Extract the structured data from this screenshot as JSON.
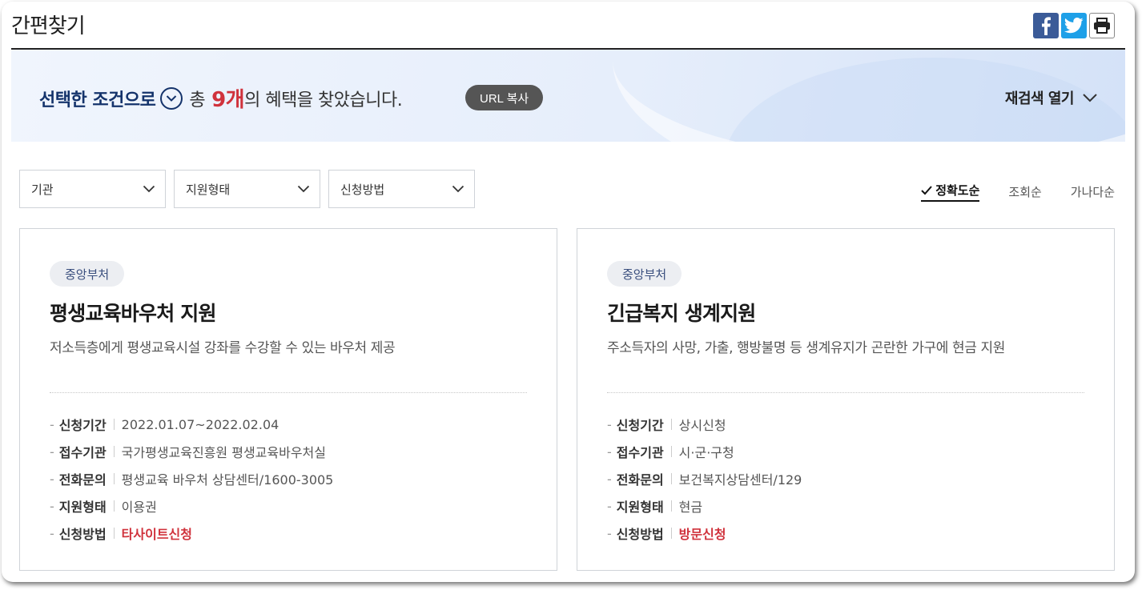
{
  "page": {
    "title": "간편찾기"
  },
  "share": {
    "icons": [
      "facebook-icon",
      "twitter-icon",
      "print-icon"
    ]
  },
  "banner": {
    "prefix": "선택한 조건으로",
    "total_label": "총",
    "count": "9개",
    "suffix": "의 혜택을 찾았습니다.",
    "url_copy": "URL 복사",
    "reopen": "재검색 열기"
  },
  "filters": [
    {
      "label": "기관"
    },
    {
      "label": "지원형태"
    },
    {
      "label": "신청방법"
    }
  ],
  "sort": [
    {
      "label": "정확도순",
      "active": true
    },
    {
      "label": "조회순",
      "active": false
    },
    {
      "label": "가나다순",
      "active": false
    }
  ],
  "cards": [
    {
      "tag": "중앙부처",
      "title": "평생교육바우처 지원",
      "desc": "저소득층에게 평생교육시설 강좌를 수강할 수 있는 바우처 제공",
      "info": [
        {
          "key": "신청기간",
          "value": "2022.01.07~2022.02.04"
        },
        {
          "key": "접수기관",
          "value": "국가평생교육진흥원 평생교육바우처실"
        },
        {
          "key": "전화문의",
          "value": "평생교육 바우처 상담센터/1600-3005"
        },
        {
          "key": "지원형태",
          "value": "이용권"
        },
        {
          "key": "신청방법",
          "value": "타사이트신청"
        }
      ]
    },
    {
      "tag": "중앙부처",
      "title": "긴급복지 생계지원",
      "desc": "주소득자의 사망, 가출, 행방불명 등 생계유지가 곤란한 가구에 현금 지원",
      "info": [
        {
          "key": "신청기간",
          "value": "상시신청"
        },
        {
          "key": "접수기관",
          "value": "시·군·구청"
        },
        {
          "key": "전화문의",
          "value": "보건복지상담센터/129"
        },
        {
          "key": "지원형태",
          "value": "현금"
        },
        {
          "key": "신청방법",
          "value": "방문신청"
        }
      ]
    }
  ],
  "colors": {
    "accent_navy": "#14336b",
    "count_red": "#d0323c",
    "facebook": "#3b5b98",
    "twitter": "#1ea0e8",
    "tag_bg": "#eceef2"
  }
}
